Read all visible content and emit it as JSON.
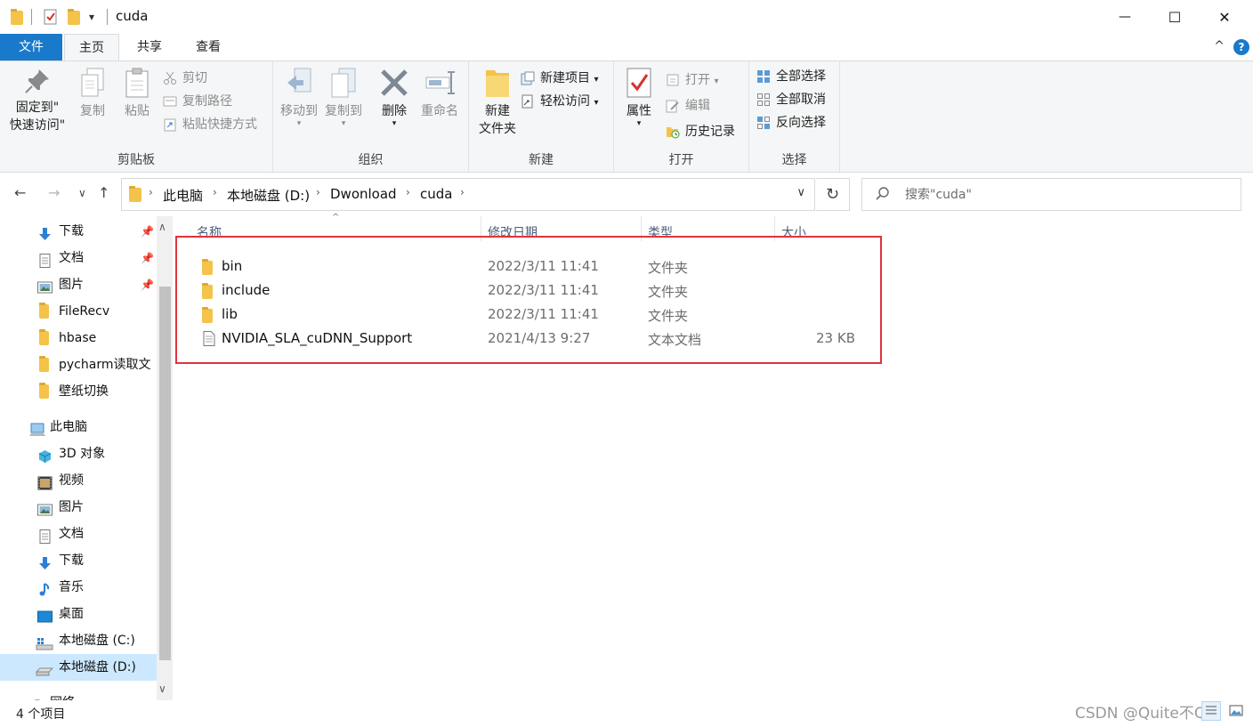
{
  "window": {
    "title": "cuda",
    "minimize_glyph": "—",
    "maximize_glyph": "☐",
    "close_glyph": "✕",
    "qat_dropdown_glyph": "▾"
  },
  "tabs": {
    "file": "文件",
    "home": "主页",
    "share": "共享",
    "view": "查看",
    "help": "?",
    "collapse": "^"
  },
  "ribbon": {
    "clipboard": {
      "label": "剪贴板",
      "pin_line1": "固定到\"",
      "pin_line2": "快速访问\"",
      "copy": "复制",
      "paste": "粘贴",
      "cut": "剪切",
      "copy_path": "复制路径",
      "paste_shortcut": "粘贴快捷方式"
    },
    "organize": {
      "label": "组织",
      "move_to": "移动到",
      "copy_to": "复制到",
      "delete": "删除",
      "rename": "重命名"
    },
    "new": {
      "label": "新建",
      "new_folder_line1": "新建",
      "new_folder_line2": "文件夹",
      "new_item": "新建项目",
      "easy_access": "轻松访问"
    },
    "open": {
      "label": "打开",
      "properties": "属性",
      "open": "打开",
      "edit": "编辑",
      "history": "历史记录"
    },
    "select": {
      "label": "选择",
      "select_all": "全部选择",
      "select_none": "全部取消",
      "invert": "反向选择"
    }
  },
  "address": {
    "crumbs": [
      "此电脑",
      "本地磁盘 (D:)",
      "Dwonload",
      "cuda"
    ],
    "search_placeholder": "搜索\"cuda\""
  },
  "navpane": {
    "quick": [
      {
        "label": "下载",
        "icon": "download-arrow-icon",
        "pinned": true
      },
      {
        "label": "文档",
        "icon": "document-icon",
        "pinned": true
      },
      {
        "label": "图片",
        "icon": "picture-icon",
        "pinned": true
      },
      {
        "label": "FileRecv",
        "icon": "folder-icon",
        "pinned": false
      },
      {
        "label": "hbase",
        "icon": "folder-icon",
        "pinned": false
      },
      {
        "label": "pycharm读取文",
        "icon": "folder-icon",
        "pinned": false
      },
      {
        "label": "壁纸切换",
        "icon": "folder-icon",
        "pinned": false
      }
    ],
    "this_pc": "此电脑",
    "pc_items": [
      {
        "label": "3D 对象",
        "icon": "cube-3d-icon"
      },
      {
        "label": "视频",
        "icon": "video-icon"
      },
      {
        "label": "图片",
        "icon": "picture-icon"
      },
      {
        "label": "文档",
        "icon": "document-icon"
      },
      {
        "label": "下载",
        "icon": "download-arrow-icon"
      },
      {
        "label": "音乐",
        "icon": "music-note-icon"
      },
      {
        "label": "桌面",
        "icon": "desktop-icon"
      },
      {
        "label": "本地磁盘 (C:)",
        "icon": "windows-drive-icon"
      },
      {
        "label": "本地磁盘 (D:)",
        "icon": "drive-icon",
        "selected": true
      }
    ],
    "network": "网络"
  },
  "columns": {
    "name": "名称",
    "date": "修改日期",
    "type": "类型",
    "size": "大小"
  },
  "files": [
    {
      "name": "bin",
      "date": "2022/3/11 11:41",
      "type": "文件夹",
      "size": "",
      "kind": "folder"
    },
    {
      "name": "include",
      "date": "2022/3/11 11:41",
      "type": "文件夹",
      "size": "",
      "kind": "folder"
    },
    {
      "name": "lib",
      "date": "2022/3/11 11:41",
      "type": "文件夹",
      "size": "",
      "kind": "folder"
    },
    {
      "name": "NVIDIA_SLA_cuDNN_Support",
      "date": "2021/4/13 9:27",
      "type": "文本文档",
      "size": "23 KB",
      "kind": "text"
    }
  ],
  "status": {
    "item_count": "4 个项目"
  },
  "watermark": "CSDN @Quite不Qu",
  "colors": {
    "accent": "#1979ca",
    "highlight_box": "#e0343b",
    "selected_nav": "#cce8ff",
    "folder": "#f3c34a"
  }
}
